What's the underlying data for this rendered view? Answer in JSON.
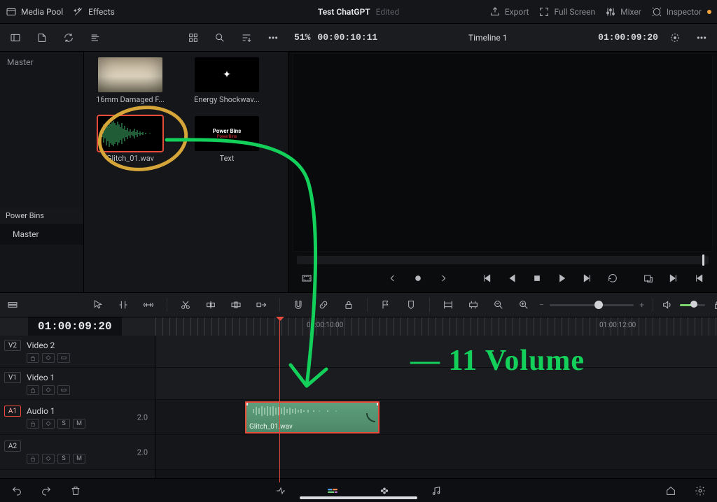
{
  "topbar": {
    "media_pool": "Media Pool",
    "effects": "Effects",
    "project_title": "Test ChatGPT",
    "edited": "Edited",
    "export": "Export",
    "fullscreen": "Full Screen",
    "mixer": "Mixer",
    "inspector": "Inspector"
  },
  "secondbar": {
    "zoom_pct": "51%",
    "source_tc": "00:00:10:11",
    "timeline_name": "Timeline 1",
    "timeline_tc": "01:00:09:20"
  },
  "pool": {
    "sidebar_master": "Master",
    "powerbins_header": "Power Bins",
    "powerbins_master": "Master",
    "clips": [
      {
        "id": "damaged",
        "label": "16mm Damaged F..."
      },
      {
        "id": "shock",
        "label": "Energy Shockwav..."
      },
      {
        "id": "glitch",
        "label": "Glitch_01.wav"
      },
      {
        "id": "text",
        "label": "Text",
        "pb": "Power Bins",
        "sub": "PowerBins"
      }
    ]
  },
  "ruler": {
    "tc_box": "01:00:09:20",
    "labels": [
      {
        "pos": 438,
        "text": "01:00:10:00"
      },
      {
        "pos": 856,
        "text": "01:00:12:00"
      }
    ]
  },
  "tracks": {
    "v2": {
      "index": "V2",
      "name": "Video 2"
    },
    "v1": {
      "index": "V1",
      "name": "Video 1"
    },
    "a1": {
      "index": "A1",
      "name": "Audio 1",
      "gain": "2.0"
    },
    "a2": {
      "index": "A2",
      "name": "",
      "gain": "2.0"
    }
  },
  "clip": {
    "name": "Glitch_01.wav"
  },
  "annotation": {
    "volume": "— 11  Volume"
  },
  "icons": {
    "lock": "lock",
    "auto": "auto",
    "display": "display",
    "solo": "S",
    "mute": "M"
  }
}
